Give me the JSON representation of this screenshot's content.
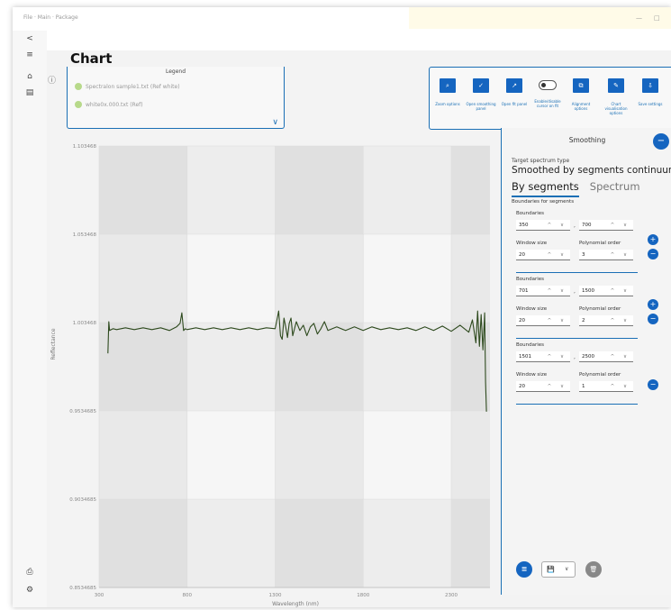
{
  "window": {
    "title": "File · Main · Package",
    "controls": [
      "—",
      "□"
    ]
  },
  "left_rail": {
    "back_icon": "<",
    "menu_icon": "≡",
    "top_icons": [
      "⌂",
      "▤"
    ],
    "bottom_icons": [
      "⎙",
      "⚙"
    ]
  },
  "page": {
    "title": "Chart",
    "info_icon": "ⓘ"
  },
  "legend": {
    "title": "Legend",
    "items": [
      "Spectralon sample1.txt (Ref white)",
      "white0x.000.txt (Ref)"
    ],
    "expand_icon": "∨"
  },
  "toolbar": {
    "items": [
      {
        "icon": "⌕",
        "label": "Zoom options"
      },
      {
        "icon": "✓",
        "label": "Open smoothing panel"
      },
      {
        "icon": "↗",
        "label": "Open fit panel"
      },
      {
        "icon": "toggle",
        "label": "Enable/disable cursor on fit"
      },
      {
        "icon": "⧉",
        "label": "Alignment options"
      },
      {
        "icon": "✎",
        "label": "Chart visualisation options"
      },
      {
        "icon": "⇩",
        "label": "Save settings"
      }
    ]
  },
  "chart_data": {
    "type": "line",
    "title": "",
    "xlabel": "Wavelength (nm)",
    "ylabel": "Reflectance",
    "xlim": [
      300,
      2520
    ],
    "ylim": [
      0.8534685,
      1.1034685
    ],
    "x_ticks": [
      "300",
      "800",
      "1300",
      "1800",
      "2300"
    ],
    "y_ticks": [
      "0.8534685",
      "0.9034685",
      "0.9534685",
      "1.003468",
      "1.053468",
      "1.103468"
    ],
    "grid": true,
    "series": [
      {
        "name": "white0x.000.txt (Ref)",
        "color": "#2e4a1e",
        "x": [
          350,
          355,
          360,
          380,
          400,
          450,
          500,
          550,
          600,
          650,
          700,
          740,
          760,
          770,
          780,
          790,
          800,
          850,
          900,
          950,
          1000,
          1050,
          1100,
          1150,
          1200,
          1250,
          1300,
          1310,
          1320,
          1330,
          1340,
          1350,
          1360,
          1370,
          1380,
          1390,
          1400,
          1420,
          1440,
          1460,
          1480,
          1500,
          1520,
          1540,
          1560,
          1580,
          1600,
          1650,
          1700,
          1750,
          1800,
          1850,
          1900,
          1950,
          2000,
          2050,
          2100,
          2150,
          2200,
          2250,
          2300,
          2350,
          2400,
          2420,
          2440,
          2450,
          2460,
          2470,
          2480,
          2490,
          2495,
          2500
        ],
        "y": [
          0.986,
          1.004,
          0.999,
          1.0,
          0.9995,
          1.0005,
          0.9995,
          1.0005,
          0.9995,
          1.0005,
          0.999,
          1.001,
          1.003,
          1.009,
          0.999,
          1.0,
          0.9995,
          1.0005,
          0.9995,
          1.0005,
          0.9995,
          1.0005,
          0.9995,
          1.0005,
          0.9995,
          1.0005,
          1.0,
          1.005,
          1.01,
          0.996,
          0.994,
          1.006,
          1.001,
          0.995,
          1.003,
          1.006,
          0.996,
          1.004,
          0.999,
          1.002,
          0.996,
          1.001,
          1.003,
          0.997,
          1.0,
          1.004,
          0.999,
          1.001,
          0.999,
          1.001,
          0.999,
          1.001,
          0.9995,
          1.0005,
          0.9995,
          1.0005,
          0.999,
          1.001,
          0.999,
          1.0015,
          0.9985,
          1.002,
          0.998,
          1.005,
          0.992,
          1.01,
          0.99,
          1.008,
          0.988,
          1.009,
          0.97,
          0.953
        ]
      }
    ]
  },
  "smoothing": {
    "title": "Smoothing",
    "close_icon": "−",
    "target_label": "Target spectrum type",
    "target_value": "Smoothed by segments continuum rem",
    "tabs": [
      "By segments",
      "Spectrum"
    ],
    "boundaries_for_segments": "Boundaries for segments",
    "segments": [
      {
        "boundaries_label": "Boundaries",
        "from": "350",
        "to": "700",
        "window_label": "Window size",
        "window": "20",
        "poly_label": "Polynomial order",
        "poly": "3"
      },
      {
        "boundaries_label": "Boundaries",
        "from": "701",
        "to": "1500",
        "window_label": "Window size",
        "window": "20",
        "poly_label": "Polynomial order",
        "poly": "2"
      },
      {
        "boundaries_label": "Boundaries",
        "from": "1501",
        "to": "2500",
        "window_label": "Window size",
        "window": "20",
        "poly_label": "Polynomial order",
        "poly": "1"
      }
    ],
    "arrows": "^ ∨",
    "separator": ",",
    "footer": {
      "save_icon": "≣",
      "disk_icon": "💾",
      "chevron": "∨",
      "delete_icon": "🗑"
    }
  }
}
